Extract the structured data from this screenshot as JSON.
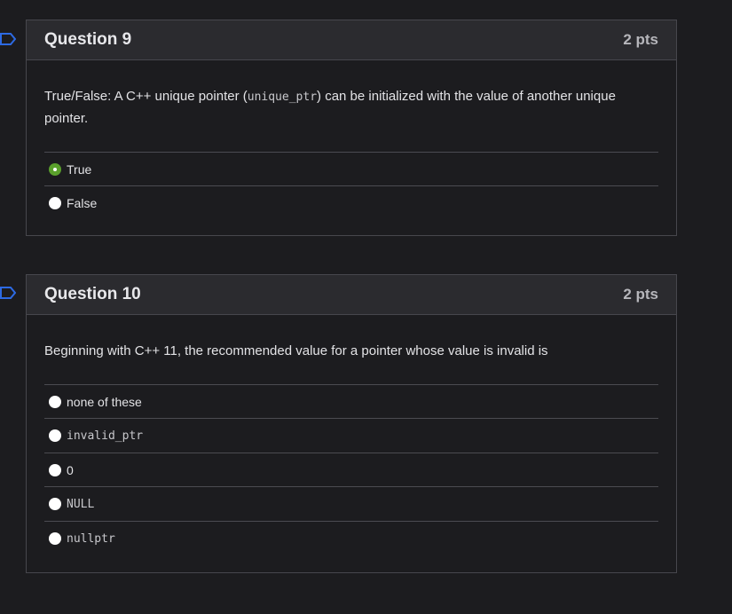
{
  "questions": [
    {
      "title": "Question 9",
      "points": "2 pts",
      "text_before": "True/False: A C++ unique pointer (",
      "code": "unique_ptr",
      "text_after": ") can be initialized with the value of another unique pointer.",
      "answers": [
        {
          "label": "True",
          "selected": true,
          "mono": false
        },
        {
          "label": "False",
          "selected": false,
          "mono": false
        }
      ]
    },
    {
      "title": "Question 10",
      "points": "2 pts",
      "text": "Beginning with C++ 11, the recommended value for a pointer whose value is invalid is",
      "answers": [
        {
          "label": "none of these",
          "selected": false,
          "mono": false
        },
        {
          "label": "invalid_ptr",
          "selected": false,
          "mono": true
        },
        {
          "label": "0",
          "selected": false,
          "mono": false
        },
        {
          "label": "NULL",
          "selected": false,
          "mono": true
        },
        {
          "label": "nullptr",
          "selected": false,
          "mono": true
        }
      ]
    }
  ],
  "colors": {
    "background": "#1c1c1f",
    "header": "#2b2b2f",
    "border": "#47474d",
    "selected_radio": "#5aa02c",
    "flag": "#2d6ae3"
  },
  "icons": [
    "bookmark-flag-icon",
    "radio-icon"
  ]
}
